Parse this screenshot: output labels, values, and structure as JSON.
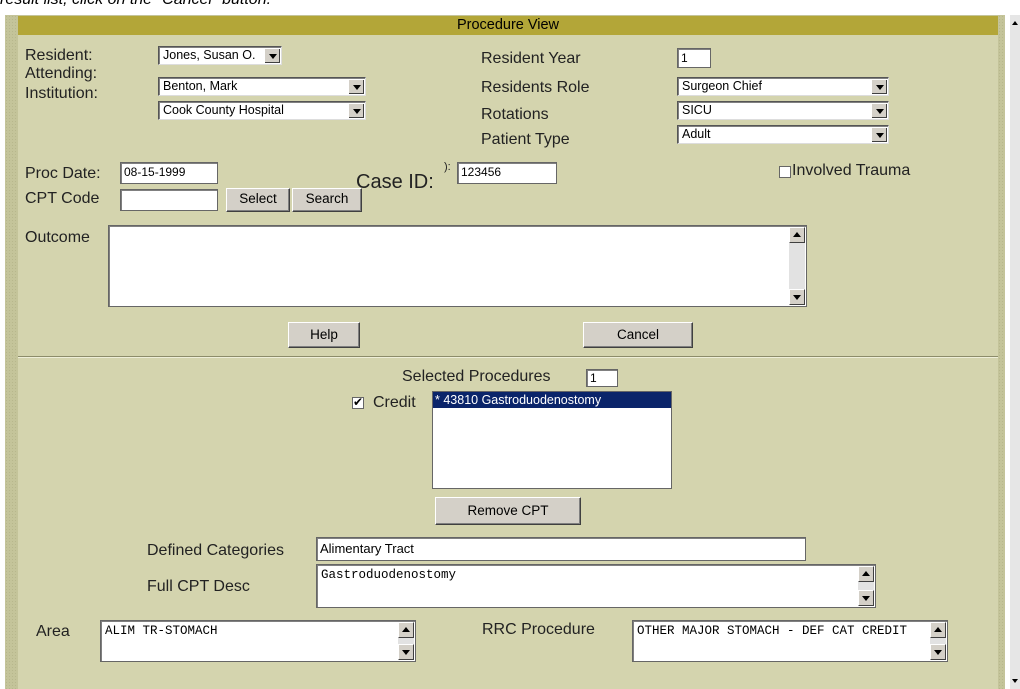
{
  "instruction_text": "result list, click on the \"Cancel\" button.",
  "window_title": "Procedure View",
  "resident": {
    "label": "Resident:",
    "value": "Jones, Susan O."
  },
  "attending": {
    "label": "Attending:",
    "value": "Benton, Mark"
  },
  "institution": {
    "label": "Institution:",
    "value": "Cook County Hospital"
  },
  "resident_year": {
    "label": "Resident Year",
    "value": "1"
  },
  "residents_role": {
    "label": "Residents Role",
    "value": "Surgeon Chief"
  },
  "rotations": {
    "label": "Rotations",
    "value": "SICU"
  },
  "patient_type": {
    "label": "Patient Type",
    "value": "Adult"
  },
  "proc_date": {
    "label": "Proc Date:",
    "value": "08-15-1999"
  },
  "case_id": {
    "label": "Case ID:",
    "extra": "):",
    "value": "123456"
  },
  "involved_trauma": {
    "label": "Involved Trauma",
    "checked": false
  },
  "cpt_code": {
    "label": "CPT Code",
    "value": "",
    "select_label": "Select",
    "search_label": "Search"
  },
  "outcome": {
    "label": "Outcome",
    "value": ""
  },
  "buttons": {
    "help": "Help",
    "cancel": "Cancel",
    "remove_cpt": "Remove CPT"
  },
  "selected_procedures": {
    "label": "Selected Procedures",
    "count": "1"
  },
  "credit": {
    "label": "Credit",
    "checked": true
  },
  "procedures_list": [
    "* 43810 Gastroduodenostomy"
  ],
  "defined_categories": {
    "label": "Defined Categories",
    "value": "Alimentary Tract"
  },
  "full_cpt_desc": {
    "label": "Full CPT Desc",
    "value": "Gastroduodenostomy"
  },
  "area": {
    "label": "Area",
    "value": "ALIM TR-STOMACH"
  },
  "rrc_procedure": {
    "label": "RRC Procedure",
    "value": "OTHER MAJOR STOMACH - DEF CAT CREDIT"
  }
}
